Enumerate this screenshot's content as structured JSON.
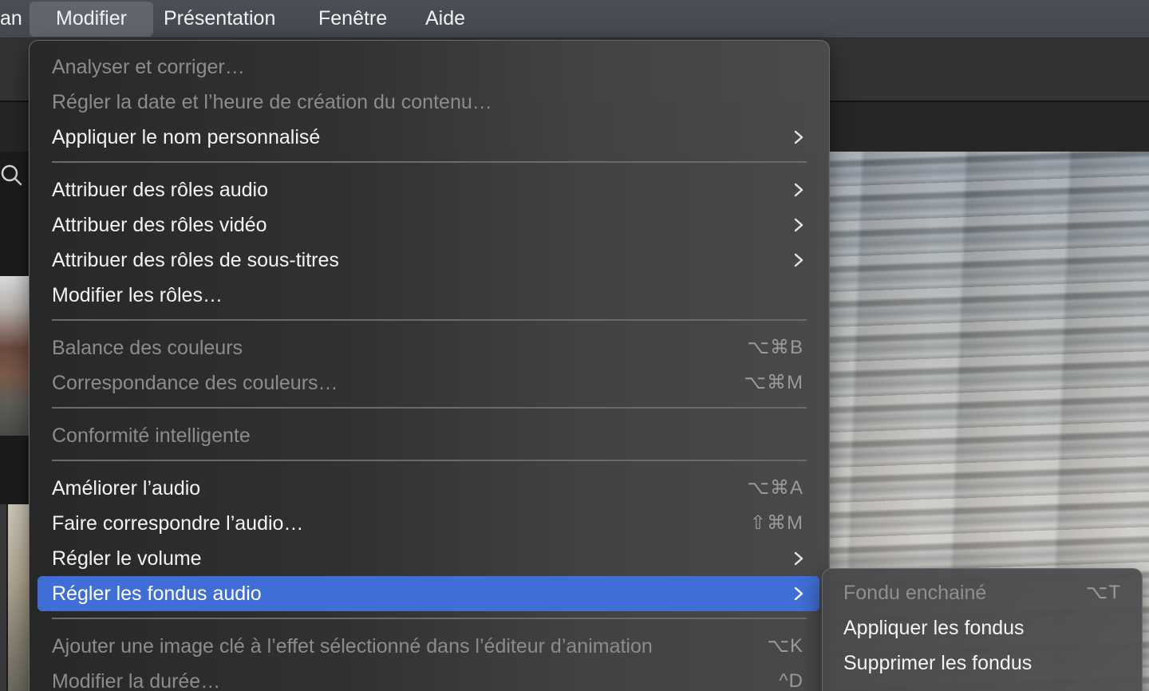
{
  "menubar": {
    "items": [
      {
        "label": "an"
      },
      {
        "label": "Modifier"
      },
      {
        "label": "Présentation"
      },
      {
        "label": "Fenêtre"
      },
      {
        "label": "Aide"
      }
    ]
  },
  "menu": {
    "items": [
      {
        "label": "Analyser et corriger…"
      },
      {
        "label": "Régler la date et l’heure de création du contenu…"
      },
      {
        "label": "Appliquer le nom personnalisé"
      },
      {
        "label": "Attribuer des rôles audio"
      },
      {
        "label": "Attribuer des rôles vidéo"
      },
      {
        "label": "Attribuer des rôles de sous-titres"
      },
      {
        "label": "Modifier les rôles…"
      },
      {
        "label": "Balance des couleurs",
        "shortcut": "⌥⌘B"
      },
      {
        "label": "Correspondance des couleurs…",
        "shortcut": "⌥⌘M"
      },
      {
        "label": "Conformité intelligente"
      },
      {
        "label": "Améliorer l’audio",
        "shortcut": "⌥⌘A"
      },
      {
        "label": "Faire correspondre l’audio…",
        "shortcut": "⇧⌘M"
      },
      {
        "label": "Régler le volume"
      },
      {
        "label": "Régler les fondus audio"
      },
      {
        "label": "Ajouter une image clé à l’effet sélectionné dans l’éditeur d’animation",
        "shortcut": "⌥K"
      },
      {
        "label": "Modifier la durée…",
        "shortcut": "^D"
      }
    ]
  },
  "submenu": {
    "items": [
      {
        "label": "Fondu enchainé",
        "shortcut": "⌥T"
      },
      {
        "label": "Appliquer les fondus"
      },
      {
        "label": "Supprimer les fondus"
      }
    ]
  },
  "colors": {
    "highlight": "#3f6fd6",
    "menubar": "#474a51",
    "menubar_active": "#62656e",
    "disabled_text": "#8c8c8e"
  },
  "icons": {
    "search": "search-icon",
    "submenu": "chevron-right-icon"
  }
}
